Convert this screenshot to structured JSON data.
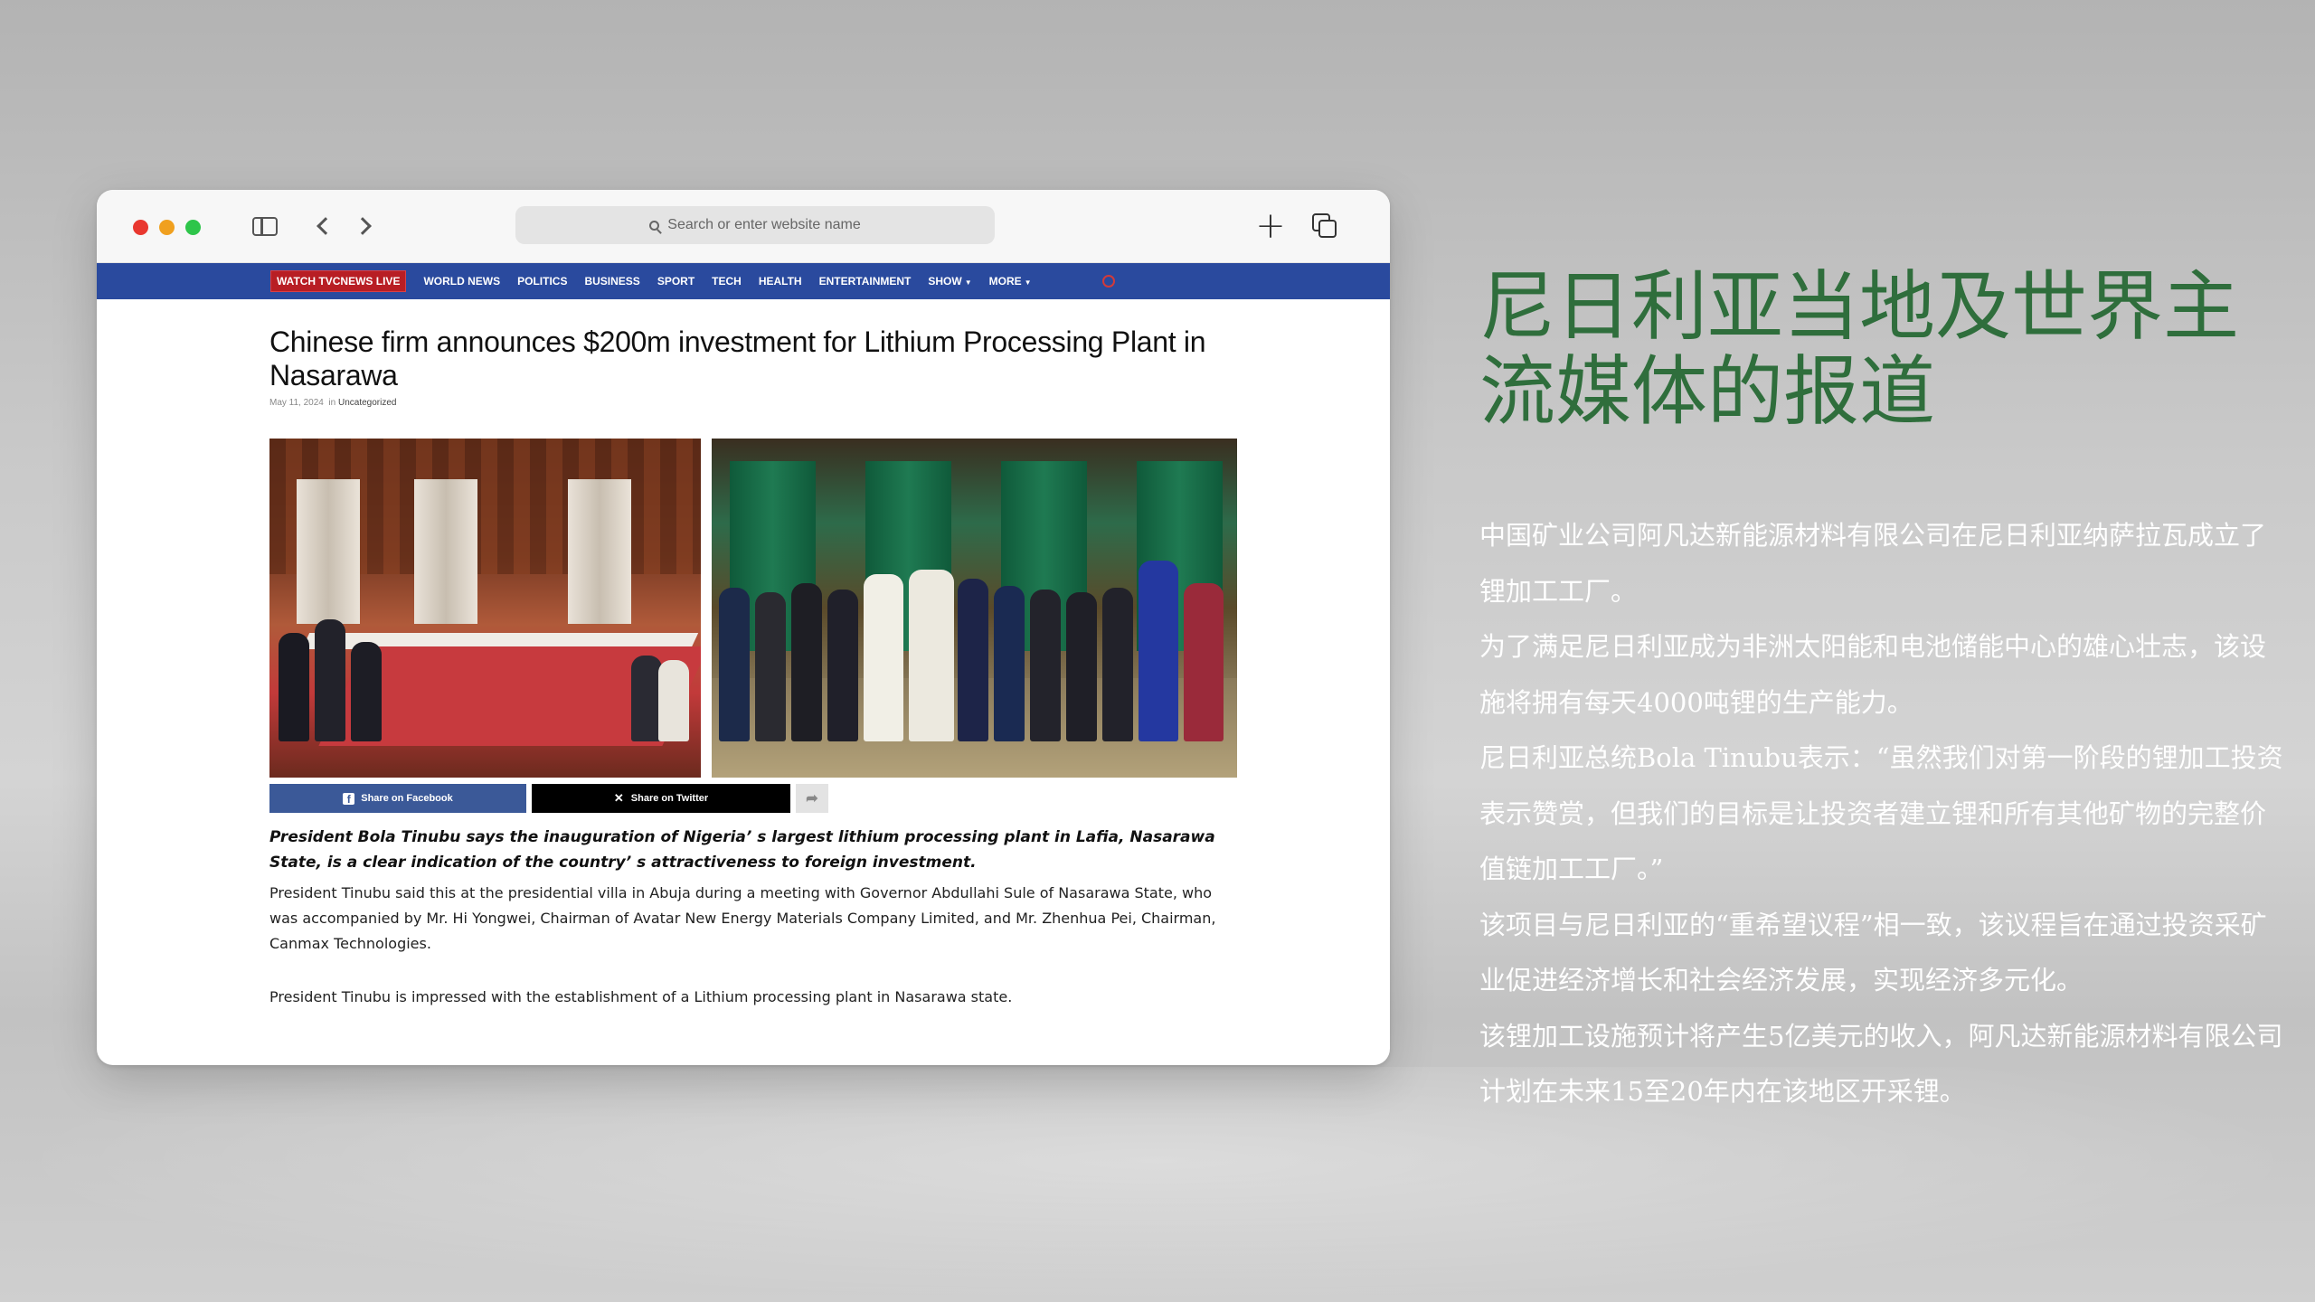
{
  "browser": {
    "address_placeholder": "Search or enter website name",
    "new_tab_glyph": "+"
  },
  "site_nav": {
    "live_label": "WATCH TVCNEWS LIVE",
    "items": [
      "WORLD NEWS",
      "POLITICS",
      "BUSINESS",
      "SPORT",
      "TECH",
      "HEALTH",
      "ENTERTAINMENT",
      "SHOW",
      "MORE"
    ]
  },
  "article": {
    "headline": "Chinese firm announces $200m investment for Lithium Processing Plant in Nasarawa",
    "date": "May 11, 2024",
    "in_label": "in",
    "category": "Uncategorized",
    "share_facebook": "Share on Facebook",
    "share_twitter": "Share on Twitter",
    "lead": "President Bola Tinubu says the inauguration of Nigeria’ s largest lithium processing plant in Lafia, Nasarawa State, is a clear indication of the country’ s attractiveness to foreign investment.",
    "paragraphs": [
      "President Tinubu said this at the presidential villa in Abuja during a meeting with Governor Abdullahi Sule of Nasarawa State, who was accompanied by Mr. Hi Yongwei, Chairman of Avatar New Energy Materials Company Limited, and Mr. Zhenhua Pei, Chairman, Canmax Technologies.",
      "President Tinubu is impressed with the establishment of a Lithium processing plant in Nasarawa state."
    ]
  },
  "panel": {
    "title": "尼日利亚当地及世界主流媒体的报道",
    "paragraphs": [
      "中国矿业公司阿凡达新能源材料有限公司在尼日利亚纳萨拉瓦成立了锂加工工厂。",
      "为了满足尼日利亚成为非洲太阳能和电池储能中心的雄心壮志，该设施将拥有每天4000吨锂的生产能力。",
      "尼日利亚总统Bola Tinubu表示：“虽然我们对第一阶段的锂加工投资表示赞赏，但我们的目标是让投资者建立锂和所有其他矿物的完整价值链加工工厂。”",
      "该项目与尼日利亚的“重希望议程”相一致，该议程旨在通过投资采矿业促进经济增长和社会经济发展，实现经济多元化。",
      "该锂加工设施预计将产生5亿美元的收入，阿凡达新能源材料有限公司计划在未来15至20年内在该地区开采锂。"
    ]
  },
  "colors": {
    "nav_blue": "#2a4a9e",
    "live_red": "#b81e24",
    "facebook_blue": "#3b5998",
    "title_green": "#2f6e3c"
  },
  "icons": [
    "close-dot-icon",
    "minimize-dot-icon",
    "zoom-dot-icon",
    "sidebar-icon",
    "chevron-left-icon",
    "chevron-right-icon",
    "search-icon",
    "plus-icon",
    "tabs-icon",
    "facebook-icon",
    "x-icon",
    "share-arrow-icon"
  ]
}
